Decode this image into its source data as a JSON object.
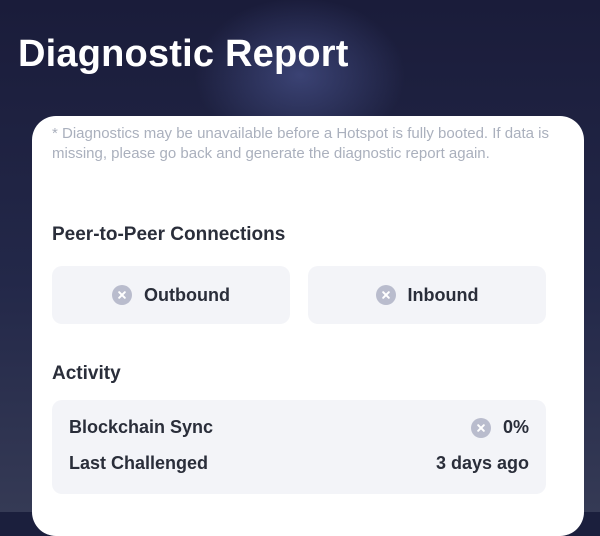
{
  "header": {
    "title": "Diagnostic Report"
  },
  "card": {
    "disclaimer": "* Diagnostics may be unavailable before a Hotspot is fully booted. If data is missing, please go back and generate the diagnostic report again.",
    "peer_section": {
      "title": "Peer-to-Peer Connections",
      "outbound_label": "Outbound",
      "outbound_icon": "x-circle-icon",
      "inbound_label": "Inbound",
      "inbound_icon": "x-circle-icon"
    },
    "activity_section": {
      "title": "Activity",
      "blockchain_sync_label": "Blockchain Sync",
      "blockchain_sync_value": "0%",
      "blockchain_sync_icon": "x-circle-icon",
      "last_challenged_label": "Last Challenged",
      "last_challenged_value": "3 days ago"
    }
  },
  "colors": {
    "background_dark": "#1b1f3d",
    "card_background": "#ffffff",
    "tile_background": "#f3f4f8",
    "status_icon_gray": "#b9bccd",
    "primary_text": "#2a2e3a",
    "muted_text": "#aab0bd"
  }
}
